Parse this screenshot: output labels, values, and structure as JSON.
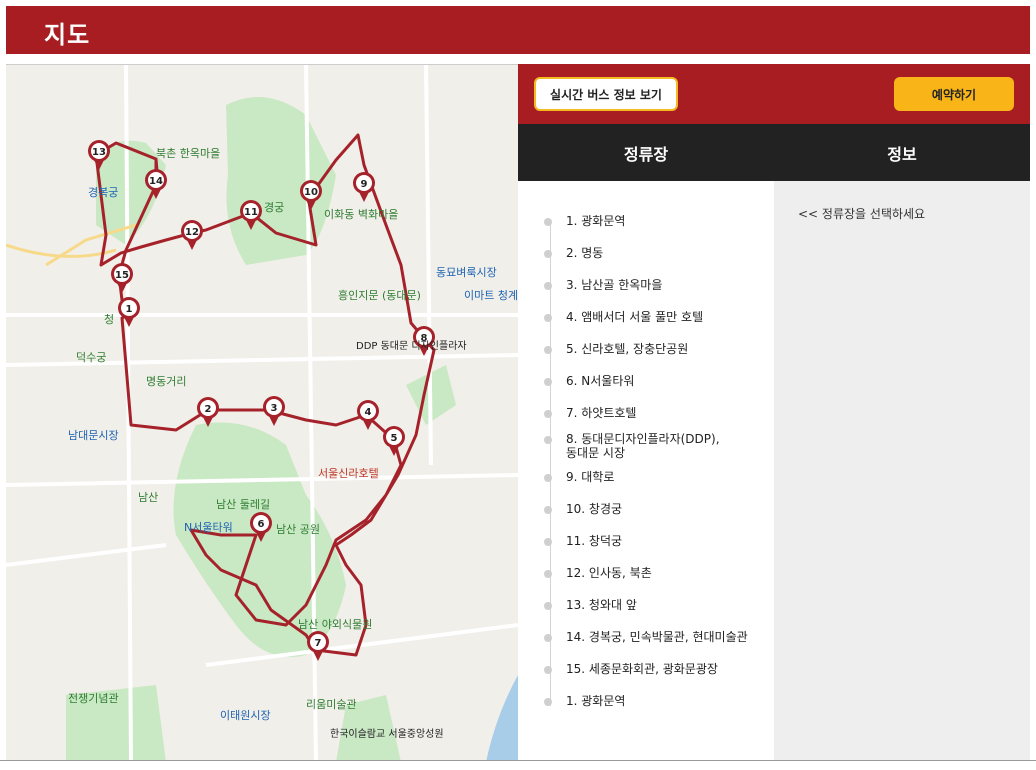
{
  "header": {
    "title": "지도"
  },
  "buttons": {
    "bus_info": "실시간 버스 정보 보기",
    "book": "예약하기"
  },
  "columns": {
    "stop": "정류장",
    "info": "정보"
  },
  "info": {
    "hint": "<< 정류장을 선택하세요"
  },
  "stops": [
    {
      "label": "1. 광화문역"
    },
    {
      "label": "2. 명동"
    },
    {
      "label": "3. 남산골 한옥마을"
    },
    {
      "label": "4. 앰배서더 서울 풀만 호텔"
    },
    {
      "label": "5. 신라호텔, 장충단공원"
    },
    {
      "label": "6. N서울타워"
    },
    {
      "label": "7. 하얏트호텔"
    },
    {
      "label": "8. 동대문디자인플라자(DDP),\n동대문 시장"
    },
    {
      "label": "9. 대학로"
    },
    {
      "label": "10. 창경궁"
    },
    {
      "label": "11. 창덕궁"
    },
    {
      "label": "12. 인사동, 북촌"
    },
    {
      "label": "13. 청와대 앞"
    },
    {
      "label": "14. 경복궁, 민속박물관, 현대미술관"
    },
    {
      "label": "15. 세종문화회관, 광화문광장"
    },
    {
      "label": "1. 광화문역"
    }
  ],
  "map": {
    "places": [
      {
        "text": "북촌 한옥마을"
      },
      {
        "text": "경복궁"
      },
      {
        "text": "경궁"
      },
      {
        "text": "이화동 벽화마을"
      },
      {
        "text": "흥인지문 (동대문)"
      },
      {
        "text": "동묘벼룩시장"
      },
      {
        "text": "이마트 청계"
      },
      {
        "text": "DDP 동대문 디자인플라자"
      },
      {
        "text": "명동거리"
      },
      {
        "text": "덕수궁"
      },
      {
        "text": "남대문시장"
      },
      {
        "text": "서울신라호텔"
      },
      {
        "text": "남산 둘레길"
      },
      {
        "text": "남산 공원"
      },
      {
        "text": "N서울타워"
      },
      {
        "text": "남산 야외식물원"
      },
      {
        "text": "전쟁기념관"
      },
      {
        "text": "리움미술관"
      },
      {
        "text": "이태원시장"
      },
      {
        "text": "한국이슬람교 서울중앙성원"
      },
      {
        "text": "청"
      },
      {
        "text": "남산"
      }
    ],
    "markers": [
      "1",
      "2",
      "3",
      "4",
      "5",
      "6",
      "7",
      "8",
      "9",
      "10",
      "11",
      "12",
      "13",
      "14",
      "15"
    ],
    "route_color": "#a5222b"
  }
}
